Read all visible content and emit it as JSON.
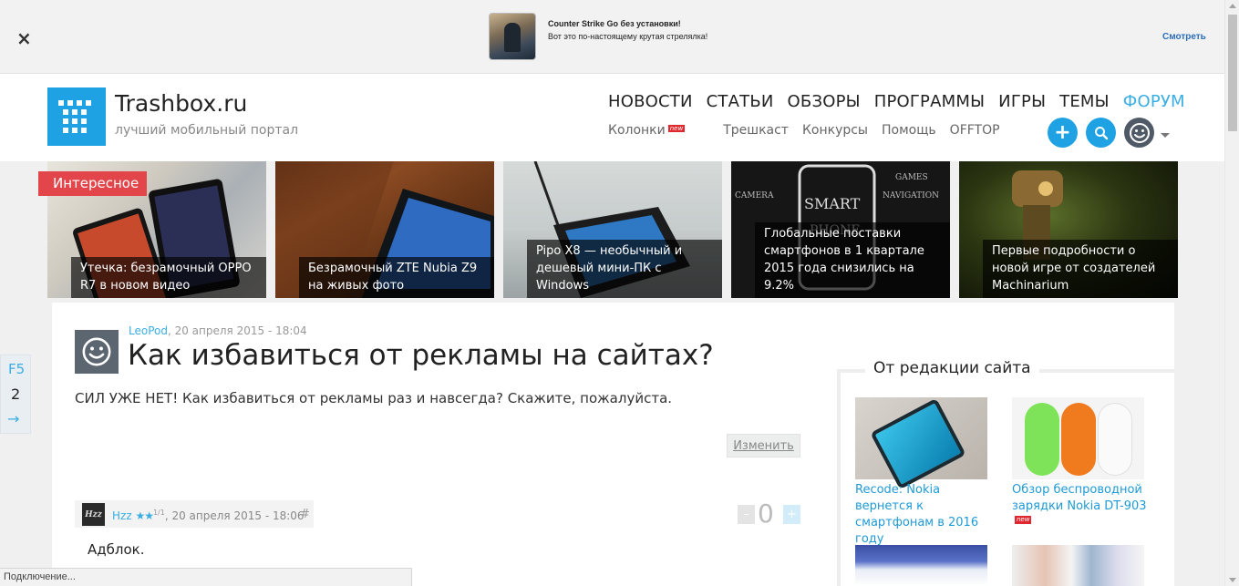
{
  "ad": {
    "close_label": "×",
    "title": "Counter Strike Go без установки!",
    "text": "Вот это по-настоящему крутая стрелялка!",
    "link": "Смотреть"
  },
  "header": {
    "site_name": "Trashbox.ru",
    "slogan": "лучший мобильный портал",
    "main_nav": [
      "НОВОСТИ",
      "СТАТЬИ",
      "ОБЗОРЫ",
      "ПРОГРАММЫ",
      "ИГРЫ",
      "ТЕМЫ",
      "ФОРУМ"
    ],
    "sub_nav": [
      "Колонки",
      "Трешкаст",
      "Конкурсы",
      "Помощь",
      "OFFTOP"
    ],
    "new_badge": "new",
    "plus_icon": "+"
  },
  "carousel": {
    "badge": "Интересное",
    "slides": [
      "Утечка: безрамочный OPPO R7 в новом видео",
      "Безрамочный ZTE Nubia Z9 на живых фото",
      "Pipo X8 — необычный и дешевый мини-ПК с Windows",
      "Глобальные поставки смартфонов в 1 квартале 2015 года снизились на 9.2%",
      "Первые подробности о новой игре от создателей Machinarium"
    ]
  },
  "post": {
    "author": "LeoPod",
    "date": ", 20 апреля 2015 - 18:04",
    "title": "Как избавиться от рекламы на сайтах?",
    "body": "СИЛ УЖЕ НЕТ! Как избавиться от рекламы раз и навсегда? Скажите, пожалуйста.",
    "edit_label": "Изменить"
  },
  "comment": {
    "avatar_text": "Hzz",
    "author": "Hzz",
    "stars": "★★",
    "rank": "1/1",
    "date": ", 20 апреля 2015 - 18:06",
    "hash": "#",
    "text": "Адблок.",
    "vote_minus": "–",
    "vote_count": "0",
    "vote_plus": "+"
  },
  "sidebar": {
    "title": "От редакции сайта",
    "items": [
      "Recode: Nokia вернется к смартфонам в 2016 году",
      "Обзор беспроводной зарядки Nokia DT-903"
    ],
    "new_badge": "new"
  },
  "f5": {
    "label": "F5",
    "count": "2",
    "arrow": "→"
  },
  "status": "Подключение...",
  "colors": {
    "accent": "#1ea2e3",
    "link": "#3aaee3",
    "badge_red": "#e2454a"
  },
  "icons": [
    "close-icon",
    "plus-icon",
    "search-icon",
    "user-smiley-icon",
    "chevron-down-icon",
    "arrow-right-icon",
    "star-icon"
  ]
}
